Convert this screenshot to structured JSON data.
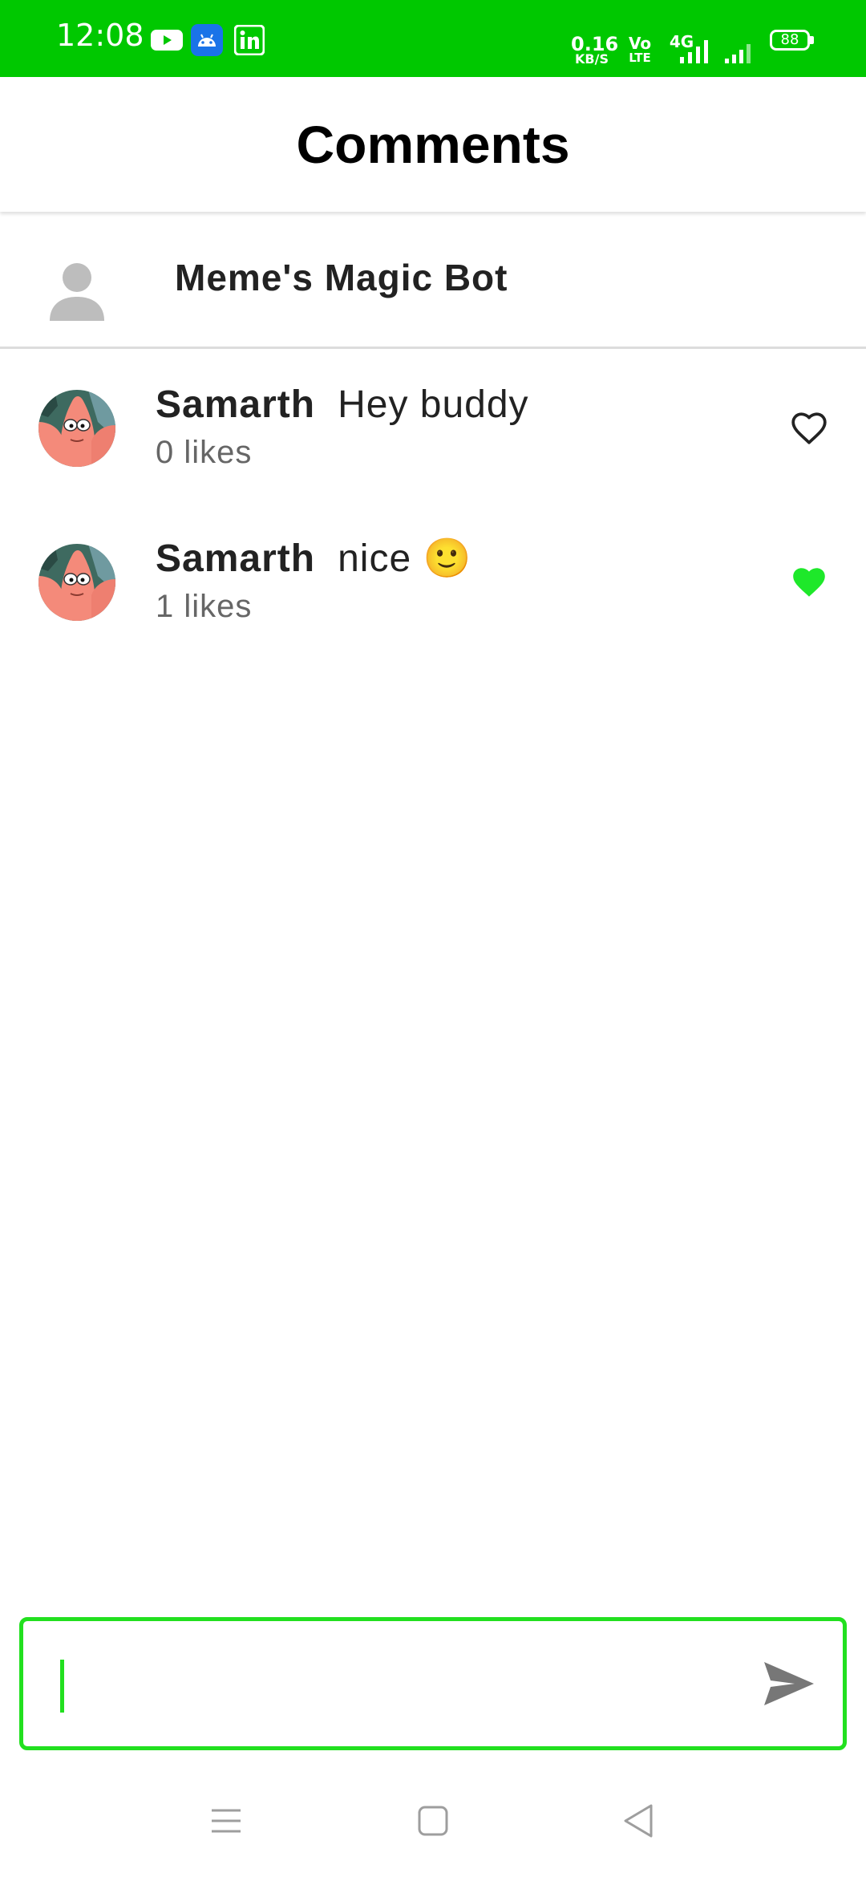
{
  "status_bar": {
    "time": "12:08",
    "notification_icons": [
      "youtube-icon",
      "android-icon",
      "linkedin-icon"
    ],
    "network_speed": "0.16",
    "network_speed_unit": "KB/S",
    "volte_top": "Vo",
    "volte_bottom": "LTE",
    "network_type": "4G",
    "battery": "88",
    "background_color": "#00c800"
  },
  "app_bar": {
    "title": "Comments"
  },
  "post_owner": {
    "name": "Meme's Magic Bot"
  },
  "comments": [
    {
      "username": "Samarth",
      "text": "Hey buddy",
      "likes": "0 likes",
      "liked": false
    },
    {
      "username": "Samarth",
      "text": "nice 🙂",
      "likes": "1 likes",
      "liked": true
    }
  ],
  "input": {
    "value": "",
    "placeholder": ""
  },
  "colors": {
    "accent": "#22e01f",
    "liked_heart": "#1ee82a",
    "status_bar": "#00c800",
    "text_primary": "#222222",
    "text_secondary": "#666666"
  }
}
